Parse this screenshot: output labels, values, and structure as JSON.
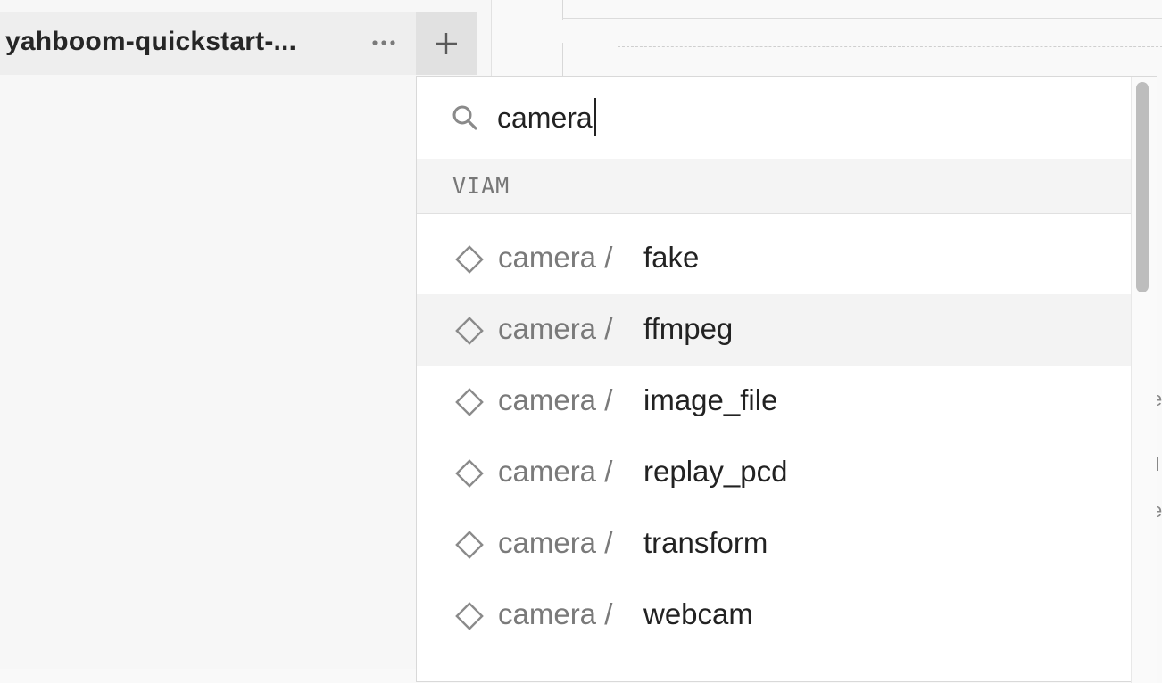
{
  "header": {
    "machine_name": "yahboom-quickstart-...",
    "more_label": "···",
    "add_label": "+"
  },
  "picker": {
    "search_value": "camera",
    "search_placeholder": "",
    "section_label": "VIAM",
    "items": [
      {
        "prefix": "camera /",
        "model": "fake",
        "icon": "diamond-icon"
      },
      {
        "prefix": "camera /",
        "model": "ffmpeg",
        "icon": "diamond-icon"
      },
      {
        "prefix": "camera /",
        "model": "image_file",
        "icon": "diamond-icon"
      },
      {
        "prefix": "camera /",
        "model": "replay_pcd",
        "icon": "diamond-icon"
      },
      {
        "prefix": "camera /",
        "model": "transform",
        "icon": "diamond-icon"
      },
      {
        "prefix": "camera /",
        "model": "webcam",
        "icon": "diamond-icon"
      }
    ],
    "highlighted_index": 1
  },
  "background_fragments": [
    "e",
    "l",
    "e"
  ]
}
